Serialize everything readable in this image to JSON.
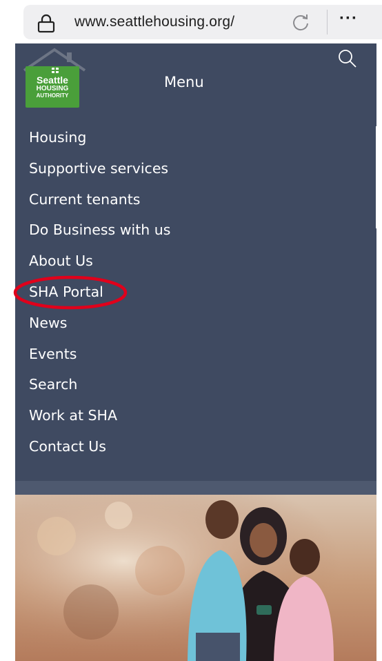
{
  "browser": {
    "url": "www.seattlehousing.org/",
    "more_label": "···",
    "icons": [
      "lock-icon",
      "reload-icon",
      "more-icon"
    ]
  },
  "header": {
    "logo": {
      "line1": "Seattle",
      "line2": "HOUSING",
      "line3": "AUTHORITY",
      "color": "#4a9f3a"
    },
    "menu_title": "Menu",
    "search_icon": "search-icon"
  },
  "menu": {
    "items": [
      {
        "label": "Housing"
      },
      {
        "label": "Supportive services"
      },
      {
        "label": "Current tenants"
      },
      {
        "label": "Do Business with us"
      },
      {
        "label": "About Us"
      },
      {
        "label": "SHA Portal",
        "highlighted": true
      },
      {
        "label": "News"
      },
      {
        "label": "Events"
      },
      {
        "label": "Search"
      },
      {
        "label": "Work at SHA"
      },
      {
        "label": "Contact Us"
      }
    ],
    "background": "#3f4a61",
    "highlight_color": "#e0001b"
  },
  "hero": {
    "description_icon": "family-photo"
  }
}
